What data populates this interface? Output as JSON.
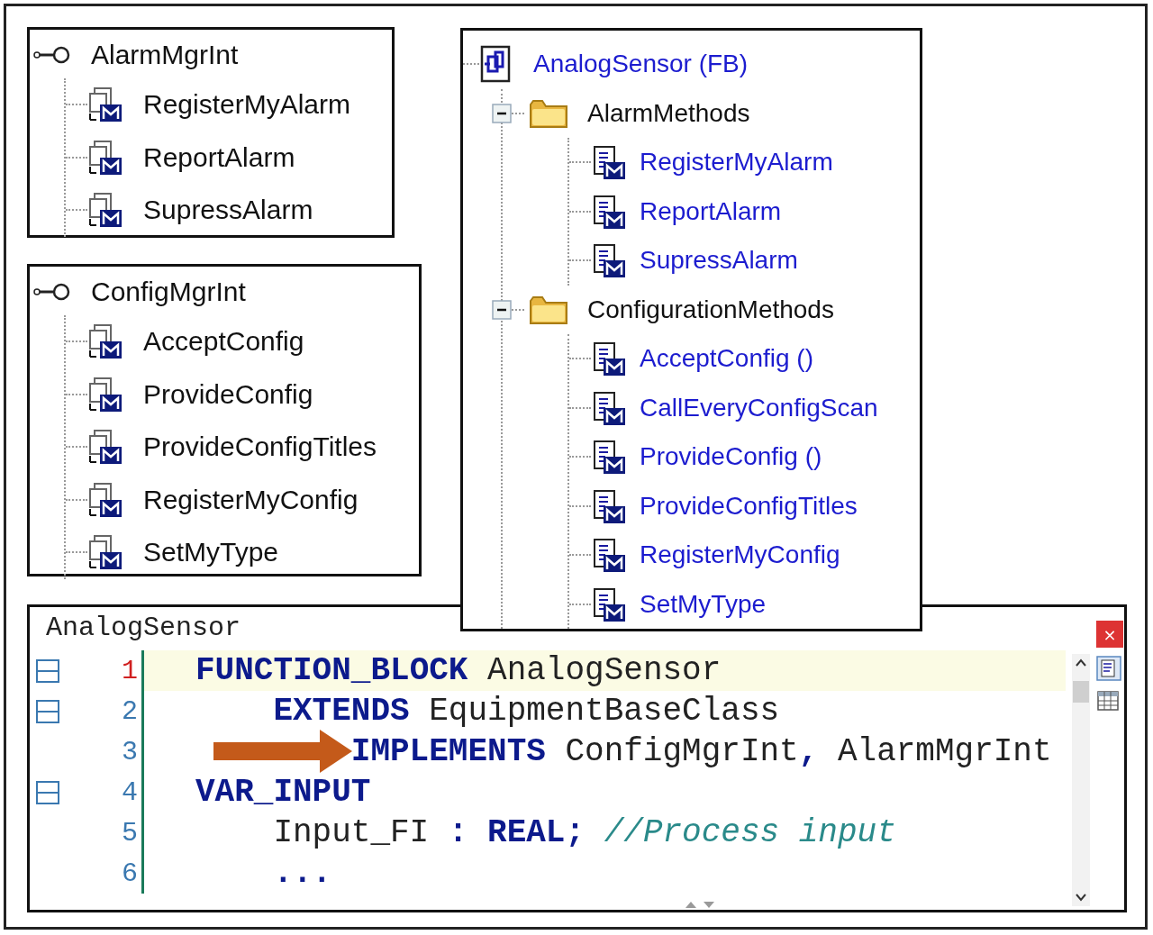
{
  "interface_panels": [
    {
      "title": "AlarmMgrInt",
      "methods": [
        "RegisterMyAlarm",
        "ReportAlarm",
        "SupressAlarm"
      ]
    },
    {
      "title": "ConfigMgrInt",
      "methods": [
        "AcceptConfig",
        "ProvideConfig",
        "ProvideConfigTitles",
        "RegisterMyConfig",
        "SetMyType"
      ]
    }
  ],
  "class_tree": {
    "kind": "function_block",
    "label": "AnalogSensor (FB)",
    "children": [
      {
        "kind": "folder",
        "label": "AlarmMethods",
        "expanded": true,
        "children": [
          {
            "kind": "method",
            "label": "RegisterMyAlarm"
          },
          {
            "kind": "method",
            "label": "ReportAlarm"
          },
          {
            "kind": "method",
            "label": "SupressAlarm"
          }
        ]
      },
      {
        "kind": "folder",
        "label": "ConfigurationMethods",
        "expanded": true,
        "children": [
          {
            "kind": "method",
            "label": "AcceptConfig ()"
          },
          {
            "kind": "method",
            "label": "CallEveryConfigScan"
          },
          {
            "kind": "method",
            "label": "ProvideConfig ()"
          },
          {
            "kind": "method",
            "label": "ProvideConfigTitles"
          },
          {
            "kind": "method",
            "label": "RegisterMyConfig"
          },
          {
            "kind": "method",
            "label": "SetMyType"
          }
        ]
      }
    ]
  },
  "editor": {
    "title": "AnalogSensor",
    "close": "×",
    "lines": [
      {
        "number": "1",
        "kind": "outer",
        "current": true,
        "fold": true,
        "arrow": false,
        "tokens": [
          {
            "kind": "keyword",
            "text": "FUNCTION_BLOCK"
          },
          {
            "kind": "ident",
            "text": "AnalogSensor"
          }
        ]
      },
      {
        "number": "2",
        "kind": "inner",
        "current": false,
        "fold": true,
        "arrow": false,
        "tokens": [
          {
            "kind": "keyword",
            "text": "EXTENDS"
          },
          {
            "kind": "ident",
            "text": "EquipmentBaseClass"
          }
        ]
      },
      {
        "number": "3",
        "kind": "deep",
        "current": false,
        "fold": false,
        "arrow": true,
        "tokens": [
          {
            "kind": "keyword",
            "text": "IMPLEMENTS"
          },
          {
            "kind": "ident",
            "text": "ConfigMgrInt"
          },
          {
            "kind": "punct",
            "text": ",",
            "attached": true
          },
          {
            "kind": "ident",
            "text": "AlarmMgrInt"
          }
        ]
      },
      {
        "number": "4",
        "kind": "outer",
        "current": false,
        "fold": true,
        "arrow": false,
        "tokens": [
          {
            "kind": "keyword",
            "text": "VAR_INPUT"
          }
        ]
      },
      {
        "number": "5",
        "kind": "inner",
        "current": false,
        "fold": false,
        "arrow": false,
        "tokens": [
          {
            "kind": "ident",
            "text": "Input_FI"
          },
          {
            "kind": "punct",
            "text": ":"
          },
          {
            "kind": "keyword",
            "text": "REAL;"
          },
          {
            "kind": "comment",
            "text": "//Process input"
          }
        ]
      },
      {
        "number": "6",
        "kind": "inner",
        "current": false,
        "fold": false,
        "arrow": false,
        "tokens": [
          {
            "kind": "punct",
            "text": "..."
          }
        ]
      }
    ]
  }
}
